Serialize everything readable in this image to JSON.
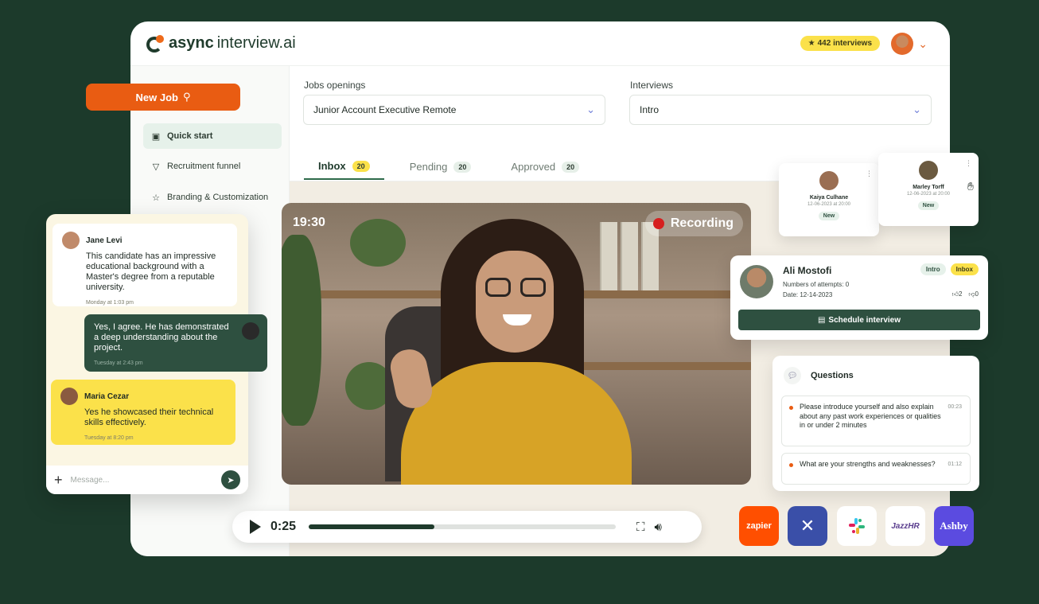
{
  "app": {
    "logo_bold": "async",
    "logo_rest": "interview.ai",
    "credits_label": "442 interviews",
    "credits_icon": "star-icon"
  },
  "actions": {
    "new_job_label": "New Job"
  },
  "sidebar": {
    "items": [
      {
        "label": "Quick start",
        "icon": "briefcase-icon",
        "active": true
      },
      {
        "label": "Recruitment funnel",
        "icon": "funnel-icon",
        "active": false
      },
      {
        "label": "Branding & Customization",
        "icon": "star-outline-icon",
        "active": false
      }
    ]
  },
  "filters": {
    "jobs_label": "Jobs openings",
    "jobs_value": "Junior Account Executive Remote",
    "interviews_label": "Interviews",
    "interviews_value": "Intro"
  },
  "tabs": [
    {
      "label": "Inbox",
      "count": "20",
      "active": true
    },
    {
      "label": "Pending",
      "count": "20",
      "active": false
    },
    {
      "label": "Approved",
      "count": "20",
      "active": false
    }
  ],
  "video": {
    "timer": "19:30",
    "recording_label": "Recording"
  },
  "player": {
    "current_time": "0:25",
    "progress": 0.41
  },
  "chat": {
    "messages": [
      {
        "author": "Jane Levi",
        "text": "This candidate has an impressive educational background with a Master's degree from a reputable university.",
        "time": "Monday at 1:03 pm"
      },
      {
        "author": "",
        "text": "Yes, I agree. He has demonstrated a deep understanding about the project.",
        "time": "Tuesday at 2:43 pm"
      },
      {
        "author": "Maria Cezar",
        "text": "Yes he showcased their technical skills effectively.",
        "time": "Tuesday at 8:20 pm"
      }
    ],
    "input_placeholder": "Message..."
  },
  "candidates": [
    {
      "name": "Kaiya Culhane",
      "date": "12-06-2023 at 20:00",
      "status": "New"
    },
    {
      "name": "Marley Torff",
      "date": "12-06-2023 at 20:00",
      "status": "New"
    }
  ],
  "selected_candidate": {
    "name": "Ali Mostofi",
    "attempts": "Numbers of attempts: 0",
    "date": "Date: 12-14-2023",
    "tag_interview": "Intro",
    "tag_status": "Inbox",
    "likes": "2",
    "dislikes": "0",
    "schedule_label": "Schedule interview"
  },
  "questions": {
    "title": "Questions",
    "items": [
      {
        "text": "Please introduce yourself and also explain about any past work experiences or qualities in or under 2 minutes",
        "time": "00:23"
      },
      {
        "text": "What are your strengths and weaknesses?",
        "time": "01:12"
      }
    ]
  },
  "integrations": [
    {
      "label": "zapier",
      "color": "#ff4f00"
    },
    {
      "label": "",
      "color": "#3a4fa8"
    },
    {
      "label": "",
      "color": "#ffffff"
    },
    {
      "label": "JazzHR",
      "color": "#ffffff"
    },
    {
      "label": "Ashby",
      "color": "#5b4be0"
    }
  ]
}
